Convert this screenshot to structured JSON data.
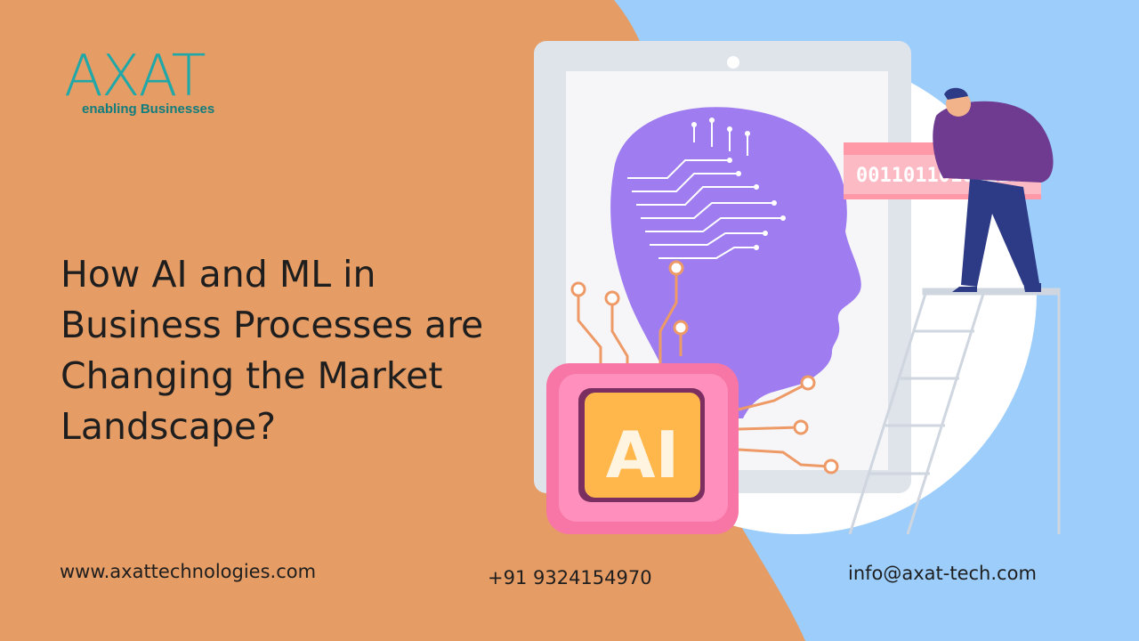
{
  "brand": {
    "name": "AXAT",
    "tagline": "enabling Businesses"
  },
  "headline": "How AI and ML in Business Processes are Changing the Market Landscape?",
  "illustration": {
    "chip_label": "AI",
    "binary_text": "00110110101111"
  },
  "footer": {
    "website": "www.axattechnologies.com",
    "phone": "+91 9324154970",
    "email": "info@axat-tech.com"
  },
  "colors": {
    "left_panel": "#e59c65",
    "right_panel": "#9ccdfb",
    "brain": "#9f7df0",
    "chip": "#f776a6",
    "logo_teal": "#20a8a8"
  }
}
